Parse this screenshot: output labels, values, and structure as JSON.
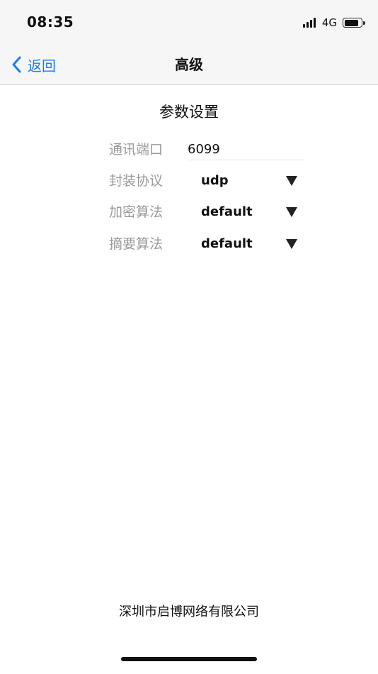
{
  "status_bar": {
    "time": "08:35",
    "network": "4G",
    "signal_bars": 4,
    "battery_level": 0.85
  },
  "nav": {
    "back_label": "返回",
    "title": "高级",
    "accent_color": "#1a7cf2"
  },
  "form": {
    "section_title": "参数设置",
    "port": {
      "label": "通讯端口",
      "value": "6099"
    },
    "protocol": {
      "label": "封装协议",
      "value": "udp"
    },
    "encryption": {
      "label": "加密算法",
      "value": "default"
    },
    "digest": {
      "label": "摘要算法",
      "value": "default"
    }
  },
  "footer": {
    "company": "深圳市启博网络有限公司"
  },
  "icons": {
    "back": "chevron-left-icon",
    "dropdown": "triangle-down-icon"
  }
}
